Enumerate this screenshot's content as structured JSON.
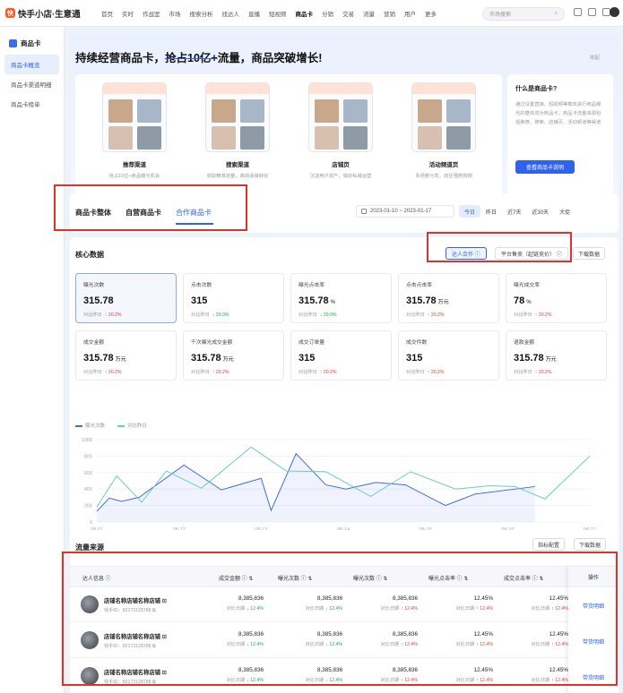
{
  "app": {
    "logo": "快手小店·生意通",
    "logo_mark": "快"
  },
  "nav": [
    "首页",
    "实时",
    "作战室",
    "市场",
    "搜索分析",
    "找达人",
    "直播",
    "短视频",
    "商品卡",
    "分销",
    "交易",
    "流量",
    "营销",
    "用户",
    "更多"
  ],
  "nav_active_index": 8,
  "search": {
    "placeholder": "市场搜索"
  },
  "sidebar": {
    "title": "商品卡",
    "items": [
      {
        "label": "商品卡概览",
        "active": true
      },
      {
        "label": "商品卡渠道明细",
        "active": false
      },
      {
        "label": "商品卡榜单",
        "active": false
      }
    ]
  },
  "banner": {
    "title_pre": "持续经营商品卡，",
    "title_strike": "抢占10亿+",
    "title_post": "流量，商品突破增长!",
    "collapse": "收起",
    "cards": [
      {
        "title": "推荐渠道",
        "sub": "抢占10亿+商品曝光机会"
      },
      {
        "title": "搜索渠道",
        "sub": "获取精准流量，高效承接转化"
      },
      {
        "title": "店铺页",
        "sub": "沉淀用户资产，做好私域运营"
      },
      {
        "title": "活动频道页",
        "sub": "多场景分发，抓住强势购物"
      }
    ],
    "info": {
      "title": "什么是商品卡?",
      "body": "通过设置直接、短视频等载体进行商品曝光的整体成为商品卡。商品卡流量来源包括推荐、搜索、店铺页、活动频道等渠道",
      "button": "查看商品卡说明"
    }
  },
  "tabs": {
    "items": [
      "商品卡整体",
      "自营商品卡",
      "合作商品卡"
    ],
    "active_index": 2
  },
  "date": {
    "range": "2023-01-10  ~  2023-01-17",
    "quick": [
      "今日",
      "昨日",
      "近7天",
      "近30天",
      "大促"
    ],
    "quick_active": 0
  },
  "core": {
    "title": "核心数据",
    "toggles": [
      "达人合作",
      "平台售卖（起链竞价）"
    ],
    "download": "下载数据",
    "metrics": [
      {
        "label": "曝光次数",
        "value": "315.78",
        "unit": "",
        "cmp": "对比昨日",
        "delta": "20.2%",
        "dir": "up",
        "selected": true
      },
      {
        "label": "点击次数",
        "value": "315",
        "unit": "",
        "cmp": "对比昨日",
        "delta": "29.9%",
        "dir": "down"
      },
      {
        "label": "曝光点击率",
        "value": "315.78",
        "unit": "%",
        "cmp": "对比昨日",
        "delta": "29.9%",
        "dir": "down"
      },
      {
        "label": "点击点击率",
        "value": "315.78",
        "unit": "万元",
        "cmp": "对比昨日",
        "delta": "20.2%",
        "dir": "up"
      },
      {
        "label": "曝光成交率",
        "value": "78",
        "unit": "%",
        "cmp": "对比昨日",
        "delta": "20.2%",
        "dir": "up"
      },
      {
        "label": "成交金额",
        "value": "315.78",
        "unit": "万元",
        "cmp": "对比昨日",
        "delta": "20.2%",
        "dir": "up"
      },
      {
        "label": "千次曝光成交金额",
        "value": "315.78",
        "unit": "万元",
        "cmp": "对比昨日",
        "delta": "20.2%",
        "dir": "up"
      },
      {
        "label": "成交订单量",
        "value": "315",
        "unit": "",
        "cmp": "对比昨日",
        "delta": "20.2%",
        "dir": "up"
      },
      {
        "label": "成交件数",
        "value": "315",
        "unit": "",
        "cmp": "对比昨日",
        "delta": "20.2%",
        "dir": "up"
      },
      {
        "label": "退款金额",
        "value": "315.78",
        "unit": "万元",
        "cmp": "对比昨日",
        "delta": "20.2%",
        "dir": "up"
      }
    ]
  },
  "chart_data": {
    "type": "line",
    "x": [
      "08-11",
      "08-12",
      "08-13",
      "08-14",
      "08-15",
      "08-16",
      "08-17"
    ],
    "ylim": [
      0,
      1000
    ],
    "yticks": [
      0,
      200,
      400,
      600,
      800,
      1000
    ],
    "legend": "top-left",
    "series": [
      {
        "name": "曝光次数",
        "color": "#3d6bf0",
        "points": [
          [
            0,
            130
          ],
          [
            0.25,
            290
          ],
          [
            0.5,
            250
          ],
          [
            0.85,
            300
          ],
          [
            1.75,
            690
          ],
          [
            2.5,
            390
          ],
          [
            3.3,
            530
          ],
          [
            3.5,
            140
          ],
          [
            4.0,
            830
          ],
          [
            4.6,
            450
          ],
          [
            5.0,
            400
          ],
          [
            5.6,
            480
          ],
          [
            6.2,
            450
          ],
          [
            7.0,
            200
          ],
          [
            7.6,
            340
          ],
          [
            8.8,
            430
          ]
        ]
      },
      {
        "name": "对比昨日",
        "color": "#6fcbbd",
        "points": [
          [
            0,
            180
          ],
          [
            0.4,
            560
          ],
          [
            0.9,
            240
          ],
          [
            1.4,
            620
          ],
          [
            2.1,
            410
          ],
          [
            3.1,
            910
          ],
          [
            3.8,
            620
          ],
          [
            4.6,
            610
          ],
          [
            5.5,
            310
          ],
          [
            6.3,
            610
          ],
          [
            7.2,
            400
          ],
          [
            7.9,
            440
          ],
          [
            8.4,
            430
          ],
          [
            9.0,
            280
          ],
          [
            9.9,
            800
          ]
        ]
      }
    ]
  },
  "traffic": {
    "title": "流量来源",
    "btn_config": "指标配置",
    "btn_download": "下载数据",
    "columns": [
      "达人信息",
      "成交金额",
      "曝光次数",
      "曝光次数",
      "曝光点击率",
      "成交点击率"
    ],
    "op_header": "操作",
    "op_link": "带货明细",
    "rows": [
      {
        "name": "店铺名称店铺名称店铺",
        "id": "快手ID：82173128788",
        "cells": [
          {
            "v": "8,385,836",
            "c": "对比日期",
            "d": "12.4%",
            "dir": "down"
          },
          {
            "v": "8,385,836",
            "c": "对比日期",
            "d": "12.4%",
            "dir": "down"
          },
          {
            "v": "8,385,836",
            "c": "对比日期",
            "d": "12.4%",
            "dir": "up"
          },
          {
            "v": "12.45%",
            "c": "对比日期",
            "d": "12.4%",
            "dir": "up"
          },
          {
            "v": "12.45%",
            "c": "对比日期",
            "d": "12.4%",
            "dir": "up"
          }
        ]
      },
      {
        "name": "店铺名称店铺名称店铺",
        "id": "快手ID：82173128788",
        "cells": [
          {
            "v": "8,385,836",
            "c": "对比日期",
            "d": "12.4%",
            "dir": "down"
          },
          {
            "v": "8,385,836",
            "c": "对比日期",
            "d": "12.4%",
            "dir": "down"
          },
          {
            "v": "8,385,836",
            "c": "对比日期",
            "d": "12.4%",
            "dir": "up"
          },
          {
            "v": "12.45%",
            "c": "对比日期",
            "d": "12.4%",
            "dir": "up"
          },
          {
            "v": "12.45%",
            "c": "对比日期",
            "d": "12.4%",
            "dir": "up"
          }
        ]
      },
      {
        "name": "店铺名称店铺名称店铺",
        "id": "快手ID：82173128788",
        "cells": [
          {
            "v": "8,385,836",
            "c": "对比日期",
            "d": "12.4%",
            "dir": "down"
          },
          {
            "v": "8,385,836",
            "c": "对比日期",
            "d": "12.4%",
            "dir": "down"
          },
          {
            "v": "8,385,836",
            "c": "对比日期",
            "d": "12.4%",
            "dir": "up"
          },
          {
            "v": "12.45%",
            "c": "对比日期",
            "d": "12.4%",
            "dir": "up"
          },
          {
            "v": "12.45%",
            "c": "对比日期",
            "d": "12.4%",
            "dir": "up"
          }
        ]
      }
    ]
  },
  "colors": {
    "accent": "#2f63ee",
    "up": "#e2393d",
    "down": "#23a55a",
    "highlight": "#e0312b"
  }
}
